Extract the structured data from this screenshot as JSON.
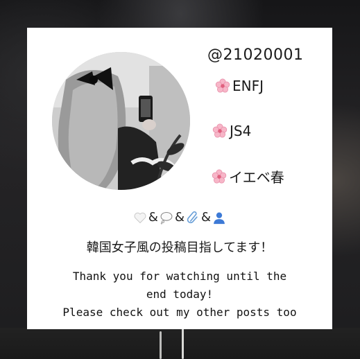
{
  "profile": {
    "handle": "@21020001",
    "tags": [
      {
        "icon": "cherry-blossom-icon",
        "text": "ENFJ"
      },
      {
        "icon": "cherry-blossom-icon",
        "text": "JS4"
      },
      {
        "icon": "cherry-blossom-icon",
        "text": "イエベ春"
      }
    ],
    "actions": [
      {
        "icon": "white-heart-icon"
      },
      {
        "icon": "speech-bubble-icon"
      },
      {
        "icon": "paperclip-icon"
      },
      {
        "icon": "person-silhouette-icon"
      }
    ],
    "separator": "&",
    "bio": "韓国女子風の投稿目指してます！",
    "thanks_line1": "Thank you for watching until the",
    "thanks_line2": "end today!",
    "thanks_line3": "Please check out my other posts too"
  },
  "colors": {
    "card": "#ffffff",
    "sakura": "#f7b6c8",
    "sakura_center": "#e0607e",
    "person": "#3d7ad6",
    "paperclip": "#6aa0d8"
  }
}
